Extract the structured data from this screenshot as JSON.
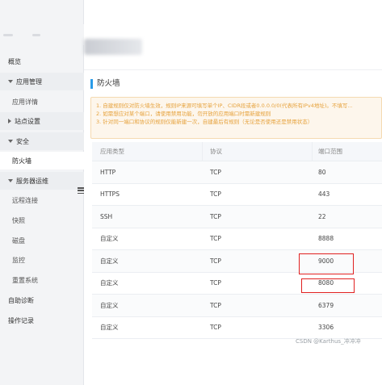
{
  "sidebar": {
    "items": [
      {
        "label": "概览",
        "level": "top"
      },
      {
        "label": "应用管理",
        "level": "group"
      },
      {
        "label": "应用详情",
        "level": "sub"
      },
      {
        "label": "站点设置",
        "level": "group-collapsed"
      },
      {
        "label": "安全",
        "level": "group"
      },
      {
        "label": "防火墙",
        "level": "sub-active"
      },
      {
        "label": "服务器运维",
        "level": "group"
      },
      {
        "label": "远程连接",
        "level": "sub"
      },
      {
        "label": "快照",
        "level": "sub"
      },
      {
        "label": "磁盘",
        "level": "sub"
      },
      {
        "label": "监控",
        "level": "sub"
      },
      {
        "label": "重置系统",
        "level": "sub"
      },
      {
        "label": "自助诊断",
        "level": "top"
      },
      {
        "label": "操作记录",
        "level": "top"
      }
    ]
  },
  "main": {
    "title": "防火墙",
    "notice": [
      "1. 自建规则仅对防火墙生效，规则IP来源可填写单个IP、CIDR段或者0.0.0.0/0(代表所有IPv4地址)。不填写...",
      "2. 如需想应对某个端口，请使用禁用功能，勿开放的应用端口时需新建规则",
      "3. 针对同一端口和协议的规则仅能新建一次，自建最后有规则（无论是否使用还是禁用状态）"
    ],
    "table": {
      "headers": [
        "应用类型",
        "协议",
        "端口范围"
      ],
      "rows": [
        [
          "HTTP",
          "TCP",
          "80"
        ],
        [
          "HTTPS",
          "TCP",
          "443"
        ],
        [
          "SSH",
          "TCP",
          "22"
        ],
        [
          "自定义",
          "TCP",
          "8888"
        ],
        [
          "自定义",
          "TCP",
          "9000"
        ],
        [
          "自定义",
          "TCP",
          "8080"
        ],
        [
          "自定义",
          "TCP",
          "6379"
        ],
        [
          "自定义",
          "TCP",
          "3306"
        ]
      ]
    }
  },
  "watermark": "CSDN @Karthus_冲冲冲",
  "colors": {
    "accent": "#2a9be8",
    "notice_text": "#e6a23c",
    "highlight": "#e02020"
  }
}
